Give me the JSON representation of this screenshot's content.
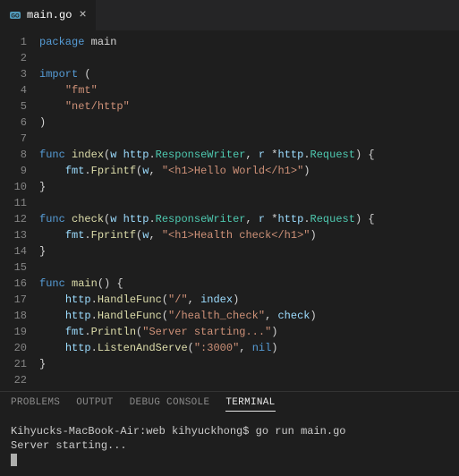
{
  "tab": {
    "filename": "main.go",
    "close_glyph": "×"
  },
  "code": {
    "lines": [
      [
        [
          "kw",
          "package"
        ],
        [
          "plain",
          " "
        ],
        [
          "plain",
          "main"
        ]
      ],
      [],
      [
        [
          "kw",
          "import"
        ],
        [
          "plain",
          " "
        ],
        [
          "pn",
          "("
        ]
      ],
      [
        [
          "plain",
          "    "
        ],
        [
          "str",
          "\"fmt\""
        ]
      ],
      [
        [
          "plain",
          "    "
        ],
        [
          "str",
          "\"net/http\""
        ]
      ],
      [
        [
          "pn",
          ")"
        ]
      ],
      [],
      [
        [
          "kw",
          "func"
        ],
        [
          "plain",
          " "
        ],
        [
          "fn",
          "index"
        ],
        [
          "pn",
          "("
        ],
        [
          "var",
          "w"
        ],
        [
          "plain",
          " "
        ],
        [
          "var",
          "http"
        ],
        [
          "pn",
          "."
        ],
        [
          "type",
          "ResponseWriter"
        ],
        [
          "pn",
          ","
        ],
        [
          "plain",
          " "
        ],
        [
          "var",
          "r"
        ],
        [
          "plain",
          " "
        ],
        [
          "op",
          "*"
        ],
        [
          "var",
          "http"
        ],
        [
          "pn",
          "."
        ],
        [
          "type",
          "Request"
        ],
        [
          "pn",
          ")"
        ],
        [
          "plain",
          " "
        ],
        [
          "pn",
          "{"
        ]
      ],
      [
        [
          "plain",
          "    "
        ],
        [
          "var",
          "fmt"
        ],
        [
          "pn",
          "."
        ],
        [
          "fn",
          "Fprintf"
        ],
        [
          "pn",
          "("
        ],
        [
          "var",
          "w"
        ],
        [
          "pn",
          ","
        ],
        [
          "plain",
          " "
        ],
        [
          "str",
          "\"<h1>Hello World</h1>\""
        ],
        [
          "pn",
          ")"
        ]
      ],
      [
        [
          "pn",
          "}"
        ]
      ],
      [],
      [
        [
          "kw",
          "func"
        ],
        [
          "plain",
          " "
        ],
        [
          "fn",
          "check"
        ],
        [
          "pn",
          "("
        ],
        [
          "var",
          "w"
        ],
        [
          "plain",
          " "
        ],
        [
          "var",
          "http"
        ],
        [
          "pn",
          "."
        ],
        [
          "type",
          "ResponseWriter"
        ],
        [
          "pn",
          ","
        ],
        [
          "plain",
          " "
        ],
        [
          "var",
          "r"
        ],
        [
          "plain",
          " "
        ],
        [
          "op",
          "*"
        ],
        [
          "var",
          "http"
        ],
        [
          "pn",
          "."
        ],
        [
          "type",
          "Request"
        ],
        [
          "pn",
          ")"
        ],
        [
          "plain",
          " "
        ],
        [
          "pn",
          "{"
        ]
      ],
      [
        [
          "plain",
          "    "
        ],
        [
          "var",
          "fmt"
        ],
        [
          "pn",
          "."
        ],
        [
          "fn",
          "Fprintf"
        ],
        [
          "pn",
          "("
        ],
        [
          "var",
          "w"
        ],
        [
          "pn",
          ","
        ],
        [
          "plain",
          " "
        ],
        [
          "str",
          "\"<h1>Health check</h1>\""
        ],
        [
          "pn",
          ")"
        ]
      ],
      [
        [
          "pn",
          "}"
        ]
      ],
      [],
      [
        [
          "kw",
          "func"
        ],
        [
          "plain",
          " "
        ],
        [
          "fn",
          "main"
        ],
        [
          "pn",
          "()"
        ],
        [
          "plain",
          " "
        ],
        [
          "pn",
          "{"
        ]
      ],
      [
        [
          "plain",
          "    "
        ],
        [
          "var",
          "http"
        ],
        [
          "pn",
          "."
        ],
        [
          "fn",
          "HandleFunc"
        ],
        [
          "pn",
          "("
        ],
        [
          "str",
          "\"/\""
        ],
        [
          "pn",
          ","
        ],
        [
          "plain",
          " "
        ],
        [
          "var",
          "index"
        ],
        [
          "pn",
          ")"
        ]
      ],
      [
        [
          "plain",
          "    "
        ],
        [
          "var",
          "http"
        ],
        [
          "pn",
          "."
        ],
        [
          "fn",
          "HandleFunc"
        ],
        [
          "pn",
          "("
        ],
        [
          "str",
          "\"/health_check\""
        ],
        [
          "pn",
          ","
        ],
        [
          "plain",
          " "
        ],
        [
          "var",
          "check"
        ],
        [
          "pn",
          ")"
        ]
      ],
      [
        [
          "plain",
          "    "
        ],
        [
          "var",
          "fmt"
        ],
        [
          "pn",
          "."
        ],
        [
          "fn",
          "Println"
        ],
        [
          "pn",
          "("
        ],
        [
          "str",
          "\"Server starting...\""
        ],
        [
          "pn",
          ")"
        ]
      ],
      [
        [
          "plain",
          "    "
        ],
        [
          "var",
          "http"
        ],
        [
          "pn",
          "."
        ],
        [
          "fn",
          "ListenAndServe"
        ],
        [
          "pn",
          "("
        ],
        [
          "str",
          "\":3000\""
        ],
        [
          "pn",
          ","
        ],
        [
          "plain",
          " "
        ],
        [
          "const",
          "nil"
        ],
        [
          "pn",
          ")"
        ]
      ],
      [
        [
          "pn",
          "}"
        ]
      ],
      []
    ]
  },
  "panel": {
    "tabs": {
      "problems": "PROBLEMS",
      "output": "OUTPUT",
      "debug": "DEBUG CONSOLE",
      "terminal": "TERMINAL"
    },
    "active": "terminal"
  },
  "terminal": {
    "line1_prompt": "Kihyucks-MacBook-Air:web kihyuckhong$ ",
    "line1_cmd": "go run main.go",
    "line2": "Server starting..."
  }
}
